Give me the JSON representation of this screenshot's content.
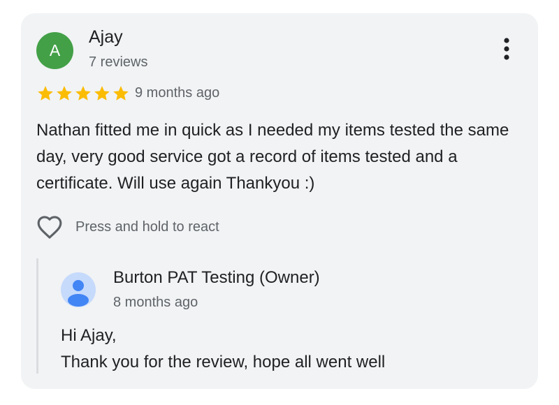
{
  "review": {
    "avatar_letter": "A",
    "avatar_color": "#43a047",
    "reviewer_name": "Ajay",
    "review_count": "7 reviews",
    "rating": 5,
    "max_rating": 5,
    "star_color": "#fbbc04",
    "time_ago": "9 months ago",
    "text": "Nathan fitted me in quick as I needed my items tested the same day, very good service got a record of items tested and a certificate. Will use again Thankyou :)",
    "more_icon": "more-vert-icon"
  },
  "react": {
    "icon": "heart-outline-icon",
    "label": "Press and hold to react"
  },
  "owner_reply": {
    "avatar_icon": "person-icon",
    "avatar_color": "#c6dafc",
    "name": "Burton PAT Testing (Owner)",
    "time_ago": "8 months ago",
    "lines": [
      "Hi Ajay,",
      "Thank you for the review, hope all went well"
    ]
  }
}
